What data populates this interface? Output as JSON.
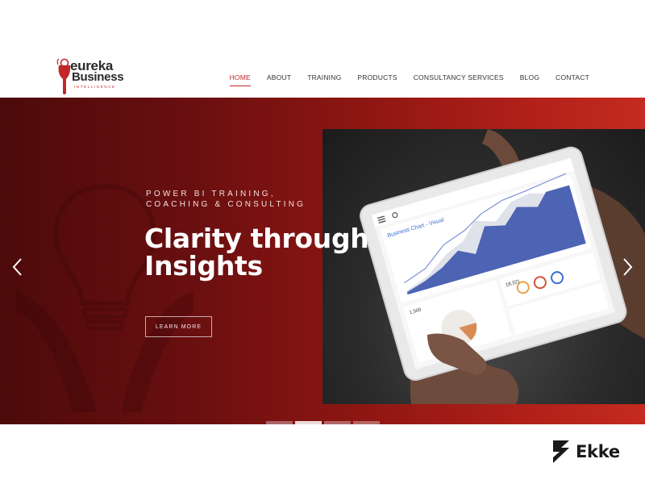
{
  "brand": {
    "word1": "eureka",
    "word2": "Business",
    "tagline": "INTELLIGENCE",
    "accent": "#c0282a"
  },
  "nav": {
    "items": [
      {
        "label": "HOME",
        "active": true
      },
      {
        "label": "ABOUT"
      },
      {
        "label": "TRAINING"
      },
      {
        "label": "PRODUCTS"
      },
      {
        "label": "CONSULTANCY SERVICES"
      },
      {
        "label": "BLOG"
      },
      {
        "label": "CONTACT"
      }
    ]
  },
  "hero": {
    "kicker": "POWER BI TRAINING,\nCOACHING & CONSULTING",
    "headline": "Clarity through\nInsights",
    "cta": "LEARN MORE",
    "prev_icon": "chevron-left-icon",
    "next_icon": "chevron-right-icon",
    "slides": 4,
    "active_slide": 2,
    "gradient": [
      "#4d0a0a",
      "#c52a1f"
    ]
  },
  "tablet": {
    "header": "Business Chart - Visual",
    "stat1": "1,500",
    "stat2": "18,321"
  },
  "watermark": {
    "text": "Ekke",
    "icon": "ekke-logo-icon"
  }
}
